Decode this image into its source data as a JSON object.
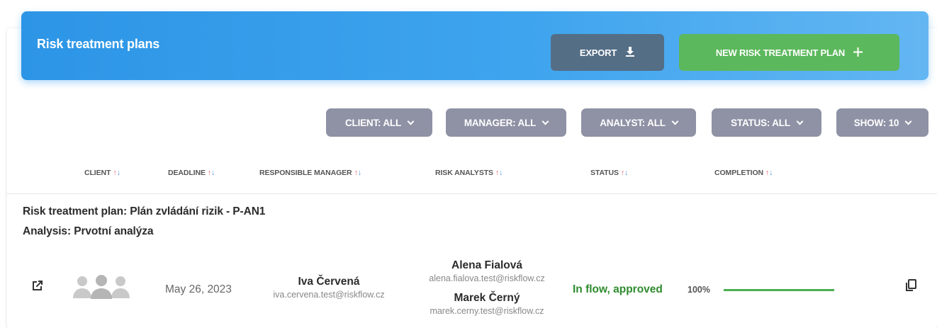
{
  "header": {
    "title": "Risk treatment plans",
    "export_label": "EXPORT",
    "export_icon": "download-icon",
    "new_label": "NEW RISK TREATMENT PLAN",
    "new_icon": "plus-icon",
    "color": "#2d95e6"
  },
  "filters": {
    "client": "CLIENT: ALL",
    "manager": "MANAGER: ALL",
    "analyst": "ANALYST: ALL",
    "status": "STATUS: ALL",
    "show": "SHOW: 10"
  },
  "columns": {
    "client": "CLIENT",
    "deadline": "DEADLINE",
    "manager": "RESPONSIBLE MANAGER",
    "analysts": "RISK ANALYSTS",
    "status": "STATUS",
    "completion": "COMPLETION",
    "sort_up": "↑",
    "sort_down": "↓"
  },
  "group": {
    "plan": "Risk treatment plan: Plán zvládání rizik - P-AN1",
    "analysis": "Analysis: Prvotní analýza"
  },
  "row": {
    "deadline": "May 26, 2023",
    "manager": {
      "name": "Iva Červená",
      "email": "iva.cervena.test@riskflow.cz"
    },
    "analysts": [
      {
        "name": "Alena Fialová",
        "email": "alena.fialova.test@riskflow.cz"
      },
      {
        "name": "Marek Černý",
        "email": "marek.cerny.test@riskflow.cz"
      }
    ],
    "status": "In flow, approved",
    "status_color": "#2e8b2e",
    "completion_label": "100%",
    "completion": 1.0
  }
}
